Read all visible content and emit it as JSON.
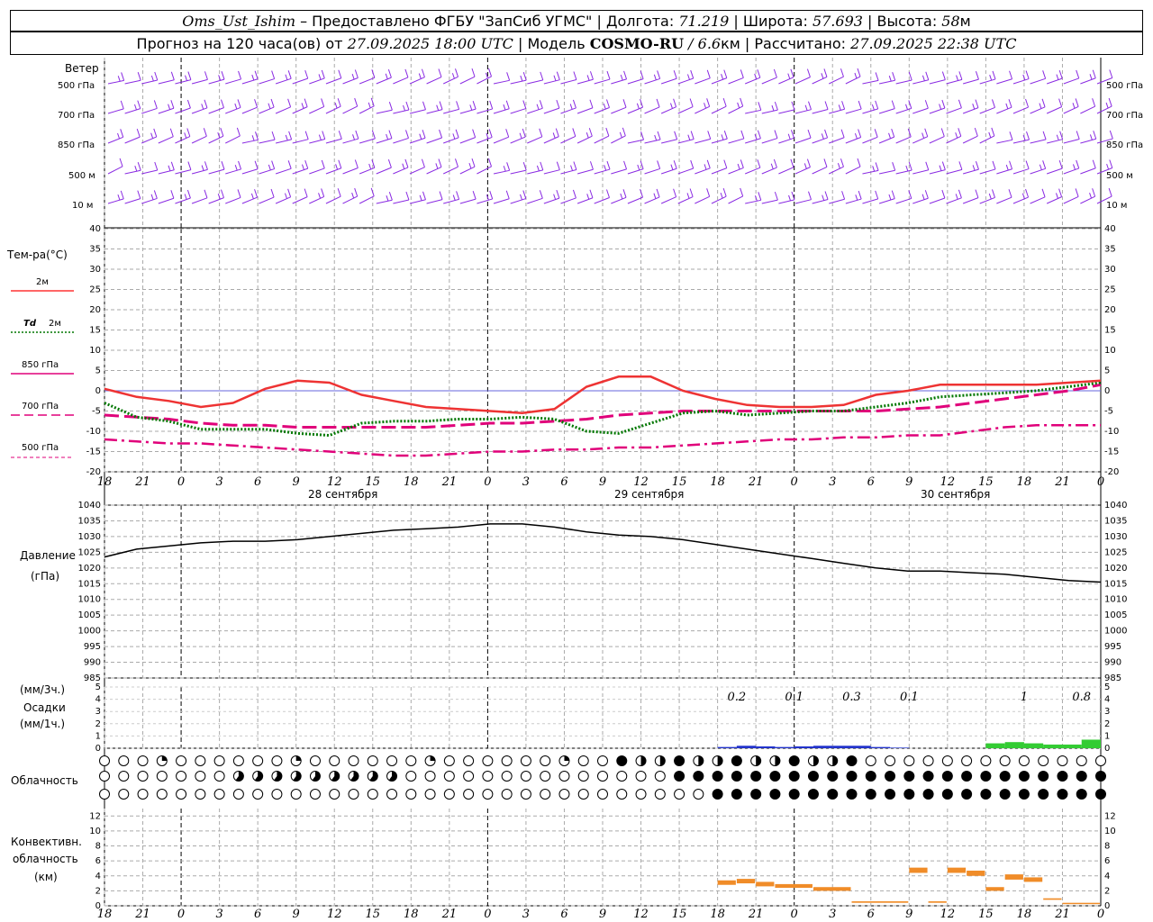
{
  "header": {
    "station": "Oms_Ust_Ishim",
    "provided_by": "– Предоставлено ФГБУ \"ЗапСиб УГМС\"",
    "lon_label": "| Долгота:",
    "lon": "71.219",
    "lat_label": "| Широта:",
    "lat": "57.693",
    "alt_label": "| Высота:",
    "alt": "58",
    "alt_unit": "м",
    "forecast_label": "Прогноз на 120 часа(ов) от",
    "forecast_time": "27.09.2025 18:00 UTC",
    "model_label": "| Модель",
    "model": "COSMO-RU",
    "resolution": "/ 6.6",
    "res_unit": "км",
    "calc_label": "| Рассчитано:",
    "calc_time": "27.09.2025 22:38 UTC"
  },
  "panels": {
    "wind": {
      "title": "Ветер",
      "levels": [
        "500 гПа",
        "700 гПа",
        "850 гПа",
        "500 м",
        "10 м"
      ],
      "color": "#8a2be2"
    },
    "temperature": {
      "title": "Тем-ра(°C)",
      "legend": [
        {
          "label": "2м",
          "color": "#ff3333",
          "style": "solid"
        },
        {
          "label_prefix": "Td",
          "label": "2м",
          "color": "#007700",
          "style": "dotted"
        },
        {
          "label": "850 гПа",
          "color": "#e0007a",
          "style": "solid"
        },
        {
          "label": "700 гПа",
          "color": "#e0007a",
          "style": "dashed"
        },
        {
          "label": "500 гПа",
          "color": "#e0007a",
          "style": "dashdot"
        }
      ]
    },
    "pressure": {
      "title": "Давление",
      "unit": "(гПа)"
    },
    "precip": {
      "unit_top": "(мм/3ч.)",
      "title": "Осадки",
      "unit_bottom": "(мм/1ч.)"
    },
    "cloud": {
      "title": "Облачность"
    },
    "convective": {
      "title1": "Конвективн.",
      "title2": "облачность",
      "unit": "(км)"
    }
  },
  "dates": [
    "28 сентября",
    "29 сентября",
    "30 сентября"
  ],
  "chart_data": [
    {
      "type": "line",
      "panel": "temperature",
      "x_hours": [
        0,
        3,
        6,
        9,
        12,
        15,
        18,
        21,
        24,
        27,
        30,
        33,
        36,
        39,
        42,
        45,
        48,
        51,
        54,
        57,
        60,
        63,
        66,
        69,
        72,
        75,
        78
      ],
      "x_tick_labels": [
        "18",
        "21",
        "0",
        "3",
        "6",
        "9",
        "12",
        "15",
        "18",
        "21",
        "0",
        "3",
        "6",
        "9",
        "12",
        "15",
        "18",
        "21",
        "0",
        "3",
        "6",
        "9",
        "12",
        "15",
        "18",
        "21",
        "0"
      ],
      "ylim": [
        -20,
        40
      ],
      "yticks": [
        -20,
        -15,
        -10,
        -5,
        0,
        5,
        10,
        15,
        20,
        25,
        30,
        35,
        40
      ],
      "series": [
        {
          "name": "2м",
          "values": [
            0.5,
            -1.5,
            -2.5,
            -4,
            -3,
            0.5,
            2.5,
            2,
            -1,
            -2.5,
            -4,
            -4.5,
            -5,
            -5.5,
            -4.5,
            1,
            3.5,
            3.5,
            0,
            -2,
            -3.5,
            -4,
            -4,
            -3.5,
            -1,
            0,
            1.5,
            1.5,
            1.5,
            1.5,
            2,
            2.5
          ]
        },
        {
          "name": "Td 2м",
          "values": [
            -3,
            -6.5,
            -7.5,
            -9.5,
            -9.5,
            -9.5,
            -10.5,
            -11,
            -8,
            -7.5,
            -7.5,
            -7,
            -7,
            -6.5,
            -7,
            -10,
            -10.5,
            -8,
            -5.5,
            -5,
            -6,
            -5.5,
            -5,
            -5,
            -4,
            -3,
            -1.5,
            -1,
            -0.5,
            0,
            1,
            2
          ]
        },
        {
          "name": "850 гПа",
          "values": [
            -6,
            -6.5,
            -7,
            -8,
            -8.5,
            -8.5,
            -9,
            -9,
            -9,
            -9,
            -9,
            -8.5,
            -8,
            -8,
            -7.5,
            -7,
            -6,
            -5.5,
            -5,
            -5,
            -5,
            -5,
            -5,
            -5,
            -5,
            -4.5,
            -4,
            -3,
            -2,
            -1,
            0,
            1.5
          ]
        },
        {
          "name": "700 гПа",
          "values": [
            -6,
            -6.5,
            -7,
            -8,
            -8.5,
            -8.5,
            -9,
            -9,
            -9,
            -9,
            -9,
            -8.5,
            -8,
            -8,
            -7.5,
            -7,
            -6,
            -5.5,
            -5,
            -5,
            -5,
            -5,
            -5,
            -5,
            -5,
            -4.5,
            -4,
            -3,
            -2,
            -1,
            0,
            1.5
          ]
        },
        {
          "name": "500 гПа",
          "values": [
            -12,
            -12.5,
            -13,
            -13,
            -13.5,
            -14,
            -14.5,
            -15,
            -15.5,
            -16,
            -16,
            -15.5,
            -15,
            -15,
            -14.5,
            -14.5,
            -14,
            -14,
            -13.5,
            -13,
            -12.5,
            -12,
            -12,
            -11.5,
            -11.5,
            -11,
            -11,
            -10,
            -9,
            -8.5,
            -8.5,
            -8.5
          ]
        }
      ]
    },
    {
      "type": "line",
      "panel": "pressure",
      "ylim": [
        985,
        1040
      ],
      "yticks": [
        985,
        990,
        995,
        1000,
        1005,
        1010,
        1015,
        1020,
        1025,
        1030,
        1035,
        1040
      ],
      "series": [
        {
          "name": "",
          "values": [
            1023.5,
            1026,
            1027,
            1028,
            1028.5,
            1028.5,
            1029,
            1030,
            1031,
            1032,
            1032.5,
            1033,
            1034,
            1034,
            1033,
            1031.5,
            1030.5,
            1030,
            1029,
            1027.5,
            1026,
            1024.5,
            1023,
            1021.5,
            1020,
            1019,
            1019,
            1018.5,
            1018,
            1017,
            1016,
            1015.5
          ]
        }
      ]
    },
    {
      "type": "bar",
      "panel": "precip",
      "ylim": [
        0,
        5
      ],
      "labels_3h": [
        {
          "hour": 33,
          "value": "0.2"
        },
        {
          "hour": 36,
          "value": "0.1"
        },
        {
          "hour": 39,
          "value": "0.3"
        },
        {
          "hour": 42,
          "value": "0.1"
        },
        {
          "hour": 48,
          "value": "1"
        },
        {
          "hour": 51,
          "value": "0.8"
        }
      ],
      "bars_1h": [
        {
          "hour": 32,
          "value": 0.1,
          "kind": "rain"
        },
        {
          "hour": 33,
          "value": 0.2,
          "kind": "rain"
        },
        {
          "hour": 34,
          "value": 0.15,
          "kind": "rain"
        },
        {
          "hour": 35,
          "value": 0.1,
          "kind": "rain"
        },
        {
          "hour": 36,
          "value": 0.15,
          "kind": "rain"
        },
        {
          "hour": 37,
          "value": 0.2,
          "kind": "rain"
        },
        {
          "hour": 38,
          "value": 0.2,
          "kind": "rain"
        },
        {
          "hour": 39,
          "value": 0.2,
          "kind": "rain"
        },
        {
          "hour": 40,
          "value": 0.1,
          "kind": "rain"
        },
        {
          "hour": 41,
          "value": 0.05,
          "kind": "rain"
        },
        {
          "hour": 46,
          "value": 0.4,
          "kind": "snow"
        },
        {
          "hour": 47,
          "value": 0.5,
          "kind": "snow"
        },
        {
          "hour": 48,
          "value": 0.4,
          "kind": "snow"
        },
        {
          "hour": 49,
          "value": 0.3,
          "kind": "snow"
        },
        {
          "hour": 50,
          "value": 0.3,
          "kind": "snow"
        },
        {
          "hour": 51,
          "value": 0.7,
          "kind": "snow"
        }
      ],
      "colors": {
        "rain": "#2233cc",
        "snow": "#33cc33"
      }
    },
    {
      "type": "bar",
      "panel": "convective",
      "ylim": [
        0,
        13
      ],
      "yticks": [
        0,
        2,
        4,
        6,
        8,
        10,
        12
      ],
      "segments": [
        {
          "h0": 32,
          "h1": 33,
          "base": 2.8,
          "top": 3.4
        },
        {
          "h0": 33,
          "h1": 34,
          "base": 3.0,
          "top": 3.6
        },
        {
          "h0": 34,
          "h1": 35,
          "base": 2.6,
          "top": 3.2
        },
        {
          "h0": 35,
          "h1": 37,
          "base": 2.4,
          "top": 2.9
        },
        {
          "h0": 37,
          "h1": 39,
          "base": 2.0,
          "top": 2.5
        },
        {
          "h0": 39,
          "h1": 42,
          "base": 0.4,
          "top": 0.6
        },
        {
          "h0": 42,
          "h1": 43,
          "base": 4.4,
          "top": 5.1
        },
        {
          "h0": 43,
          "h1": 44,
          "base": 0.4,
          "top": 0.6
        },
        {
          "h0": 44,
          "h1": 45,
          "base": 4.4,
          "top": 5.1
        },
        {
          "h0": 45,
          "h1": 46,
          "base": 4.0,
          "top": 4.7
        },
        {
          "h0": 46,
          "h1": 47,
          "base": 2.0,
          "top": 2.5
        },
        {
          "h0": 47,
          "h1": 48,
          "base": 3.5,
          "top": 4.2
        },
        {
          "h0": 48,
          "h1": 49,
          "base": 3.2,
          "top": 3.8
        },
        {
          "h0": 49,
          "h1": 50,
          "base": 0.8,
          "top": 1.0
        },
        {
          "h0": 50,
          "h1": 52,
          "base": 0.3,
          "top": 0.4
        }
      ],
      "color": "#f08c28"
    }
  ]
}
